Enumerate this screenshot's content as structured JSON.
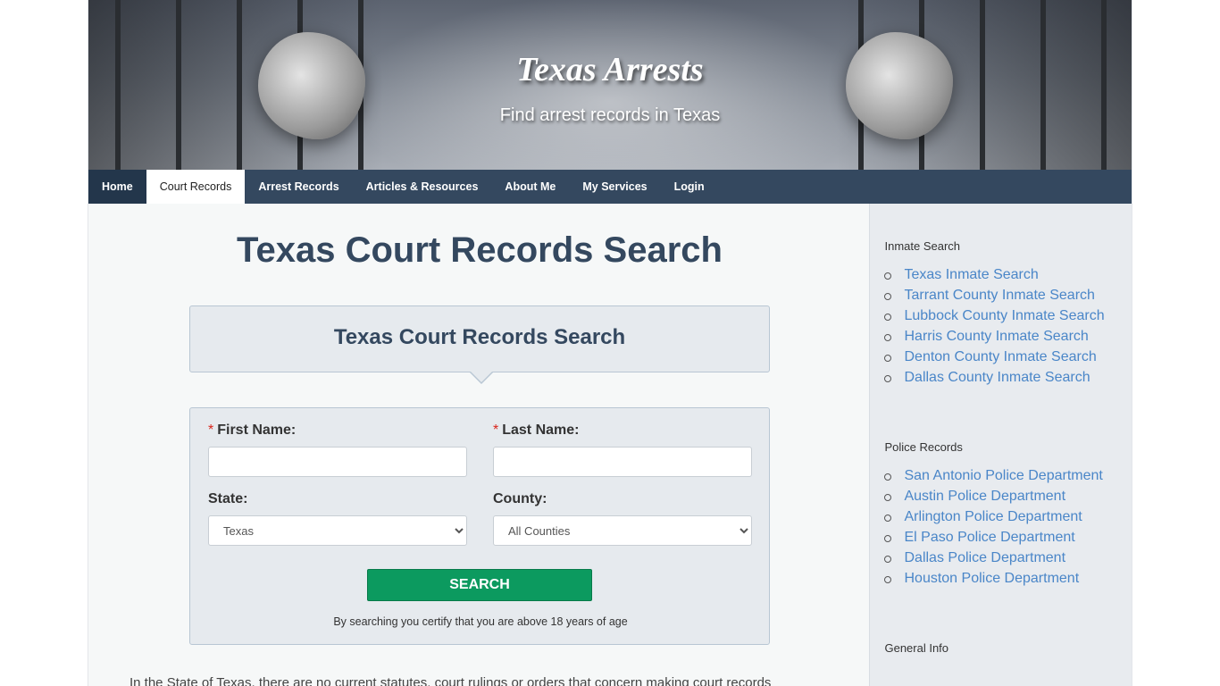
{
  "header": {
    "title": "Texas Arrests",
    "tagline": "Find arrest records in Texas"
  },
  "nav": {
    "items": [
      "Home",
      "Court Records",
      "Arrest Records",
      "Articles & Resources",
      "About Me",
      "My Services",
      "Login"
    ],
    "active": "Court Records"
  },
  "main": {
    "page_title": "Texas Court Records Search",
    "box_title": "Texas Court Records Search",
    "form": {
      "required_marker": "*",
      "first_name_label": "First Name:",
      "last_name_label": "Last Name:",
      "state_label": "State:",
      "state_value": "Texas",
      "county_label": "County:",
      "county_value": "All Counties",
      "search_label": "SEARCH",
      "disclaimer": "By searching you certify that you are above 18 years of age"
    },
    "intro_text": "In the State of Texas, there are no current statutes, court rulings or orders that concern making court records"
  },
  "sidebar": {
    "inmate_heading": "Inmate Search",
    "inmate_links": [
      "Texas Inmate Search",
      "Tarrant County Inmate Search",
      "Lubbock County Inmate Search",
      "Harris County Inmate Search",
      "Denton County Inmate Search",
      "Dallas County Inmate Search"
    ],
    "police_heading": "Police Records",
    "police_links": [
      "San Antonio Police Department",
      "Austin Police Department",
      "Arlington Police Department",
      "El Paso Police Department",
      "Dallas Police Department",
      "Houston Police Department"
    ],
    "general_heading": "General Info"
  },
  "colors": {
    "nav_bg": "#34485f",
    "search_button": "#0c9a5f",
    "link": "#4a86c8"
  }
}
